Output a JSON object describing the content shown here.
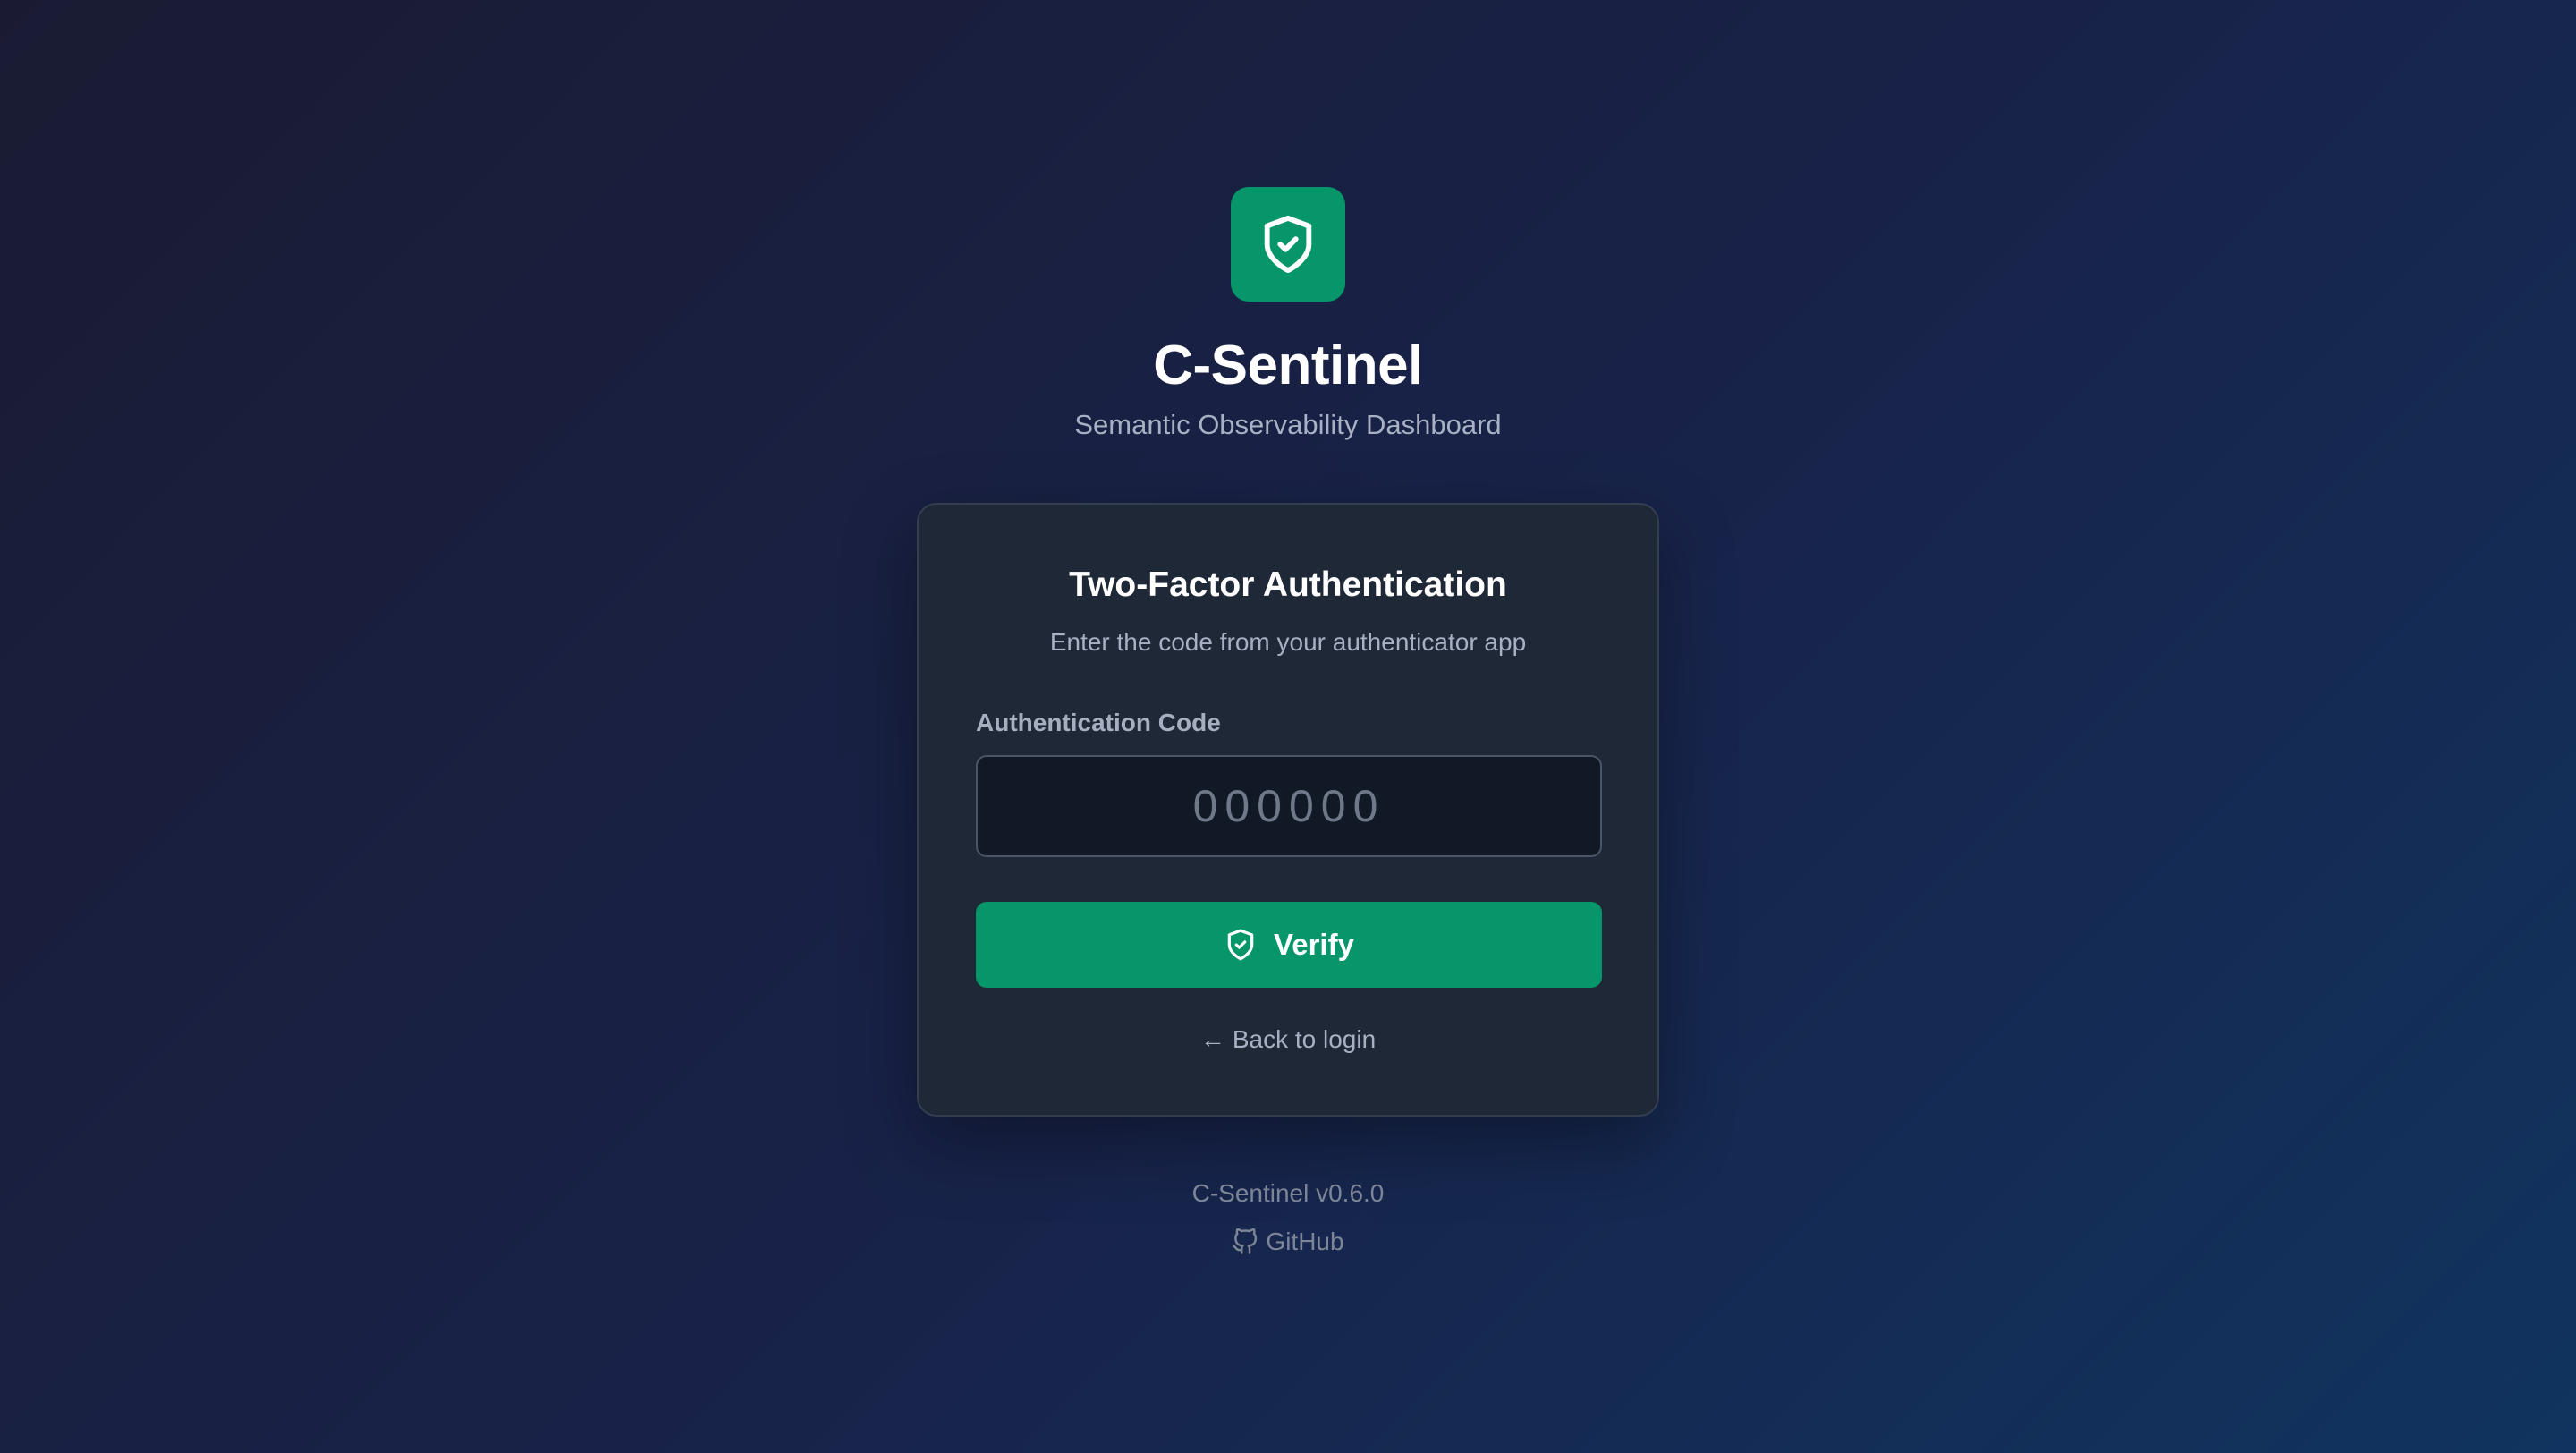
{
  "brand": {
    "logo_icon": "shield-check-icon",
    "title": "C-Sentinel",
    "subtitle": "Semantic Observability Dashboard",
    "accent_color": "#079669"
  },
  "auth_card": {
    "title": "Two-Factor Authentication",
    "subtitle": "Enter the code from your authenticator app",
    "field_label": "Authentication Code",
    "code_input": {
      "value": "",
      "placeholder": "000000"
    },
    "verify_button": {
      "icon": "shield-check-icon",
      "label": "Verify"
    },
    "back_link": {
      "icon": "arrow-left-icon",
      "arrow_glyph": "←",
      "label": "Back to login"
    }
  },
  "footer": {
    "version": "C-Sentinel v0.6.0",
    "github": {
      "icon": "github-icon",
      "label": "GitHub"
    }
  }
}
